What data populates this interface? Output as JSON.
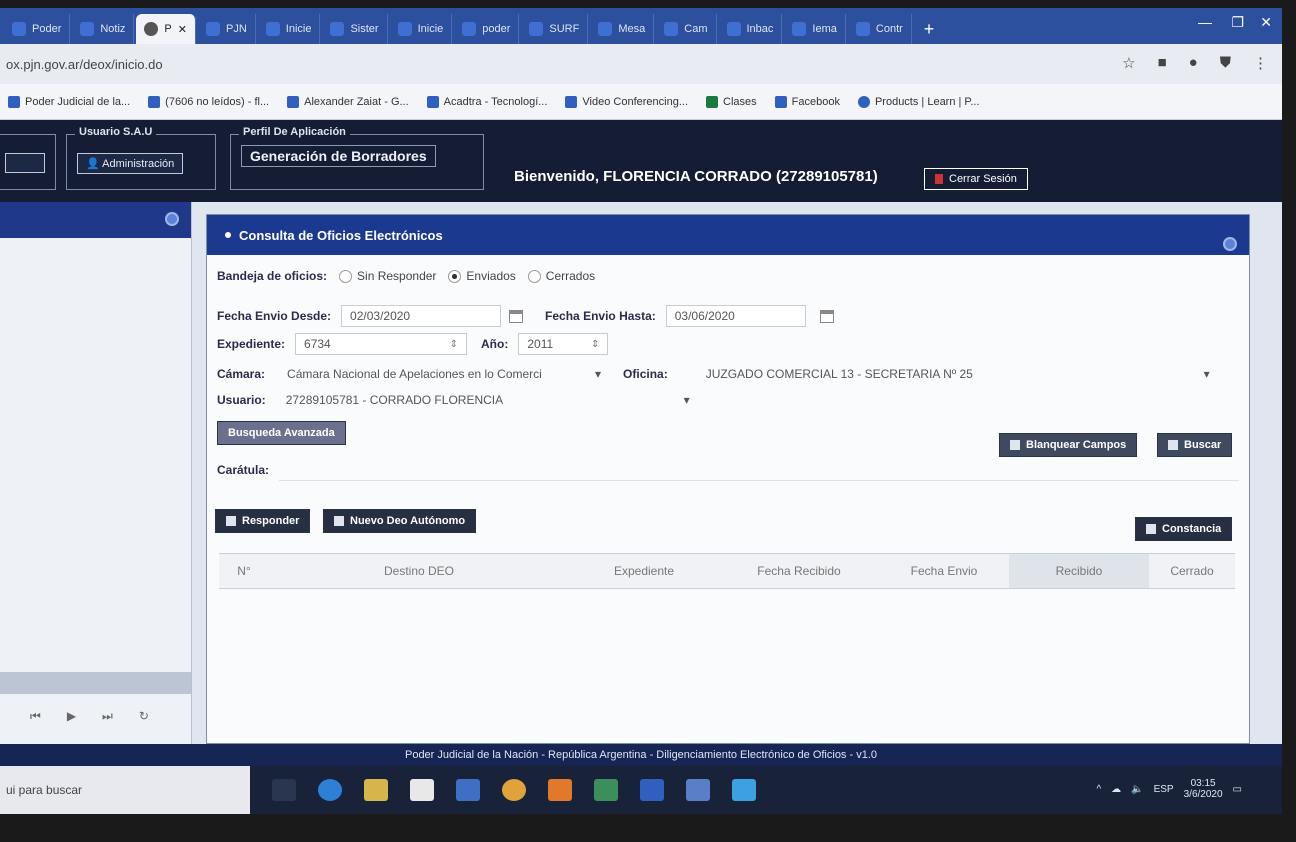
{
  "browser": {
    "tabs": [
      {
        "label": "Poder",
        "active": false
      },
      {
        "label": "Notiz",
        "active": false
      },
      {
        "label": "P",
        "active": true
      },
      {
        "label": "PJN",
        "active": false
      },
      {
        "label": "Inicie",
        "active": false
      },
      {
        "label": "Sister",
        "active": false
      },
      {
        "label": "Inicie",
        "active": false
      },
      {
        "label": "poder",
        "active": false
      },
      {
        "label": "SURF",
        "active": false
      },
      {
        "label": "Mesa",
        "active": false
      },
      {
        "label": "Cam",
        "active": false
      },
      {
        "label": "Inbac",
        "active": false
      },
      {
        "label": "Iema",
        "active": false
      },
      {
        "label": "Contr",
        "active": false
      }
    ],
    "url": "ox.pjn.gov.ar/deox/inicio.do",
    "bookmarks": [
      "Poder Judicial de la...",
      "(7606 no leídos) - fl...",
      "Alexander Zaiat - G...",
      "Acadtra - Tecnologí...",
      "Video Conferencing...",
      "Clases",
      "Facebook",
      "Products | Learn | P..."
    ]
  },
  "header": {
    "usuario_legend": "Usuario S.A.U",
    "admin_button": "Administración",
    "perfil_legend": "Perfil De Aplicación",
    "perfil_value": "Generación de Borradores",
    "welcome": "Bienvenido, FLORENCIA CORRADO (27289105781)",
    "logout": "Cerrar Sesión"
  },
  "panel": {
    "title": "Consulta de Oficios Electrónicos",
    "bandeja_label": "Bandeja de oficios:",
    "bandeja_options": [
      {
        "label": "Sin Responder",
        "selected": false
      },
      {
        "label": "Enviados",
        "selected": true
      },
      {
        "label": "Cerrados",
        "selected": false
      }
    ],
    "fecha_desde_label": "Fecha Envio Desde:",
    "fecha_desde_value": "02/03/2020",
    "fecha_hasta_label": "Fecha Envio Hasta:",
    "fecha_hasta_value": "03/06/2020",
    "expediente_label": "Expediente:",
    "expediente_value": "6734",
    "anio_label": "Año:",
    "anio_value": "2011",
    "camara_label": "Cámara:",
    "camara_value": "Cámara Nacional de Apelaciones en lo Comerci",
    "oficina_label": "Oficina:",
    "oficina_value": "JUZGADO COMERCIAL 13 - SECRETARIA Nº 25",
    "usuario_label": "Usuario:",
    "usuario_value": "27289105781 - CORRADO FLORENCIA",
    "busqueda_avanzada": "Busqueda Avanzada",
    "blanquear": "Blanquear Campos",
    "buscar": "Buscar",
    "caratula_label": "Carátula:",
    "responder": "Responder",
    "nuevo_deo": "Nuevo Deo Autónomo",
    "constancia": "Constancia",
    "columns": [
      "N°",
      "Destino DEO",
      "Expediente",
      "Fecha Recibido",
      "Fecha Envio",
      "Recibido",
      "Cerrado"
    ]
  },
  "footer": "Poder Judicial de la Nación - República Argentina - Diligenciamiento Electrónico de Oficios - v1.0",
  "taskbar": {
    "search": "ui para buscar",
    "lang": "ESP",
    "time": "03:15",
    "date": "3/6/2020"
  }
}
